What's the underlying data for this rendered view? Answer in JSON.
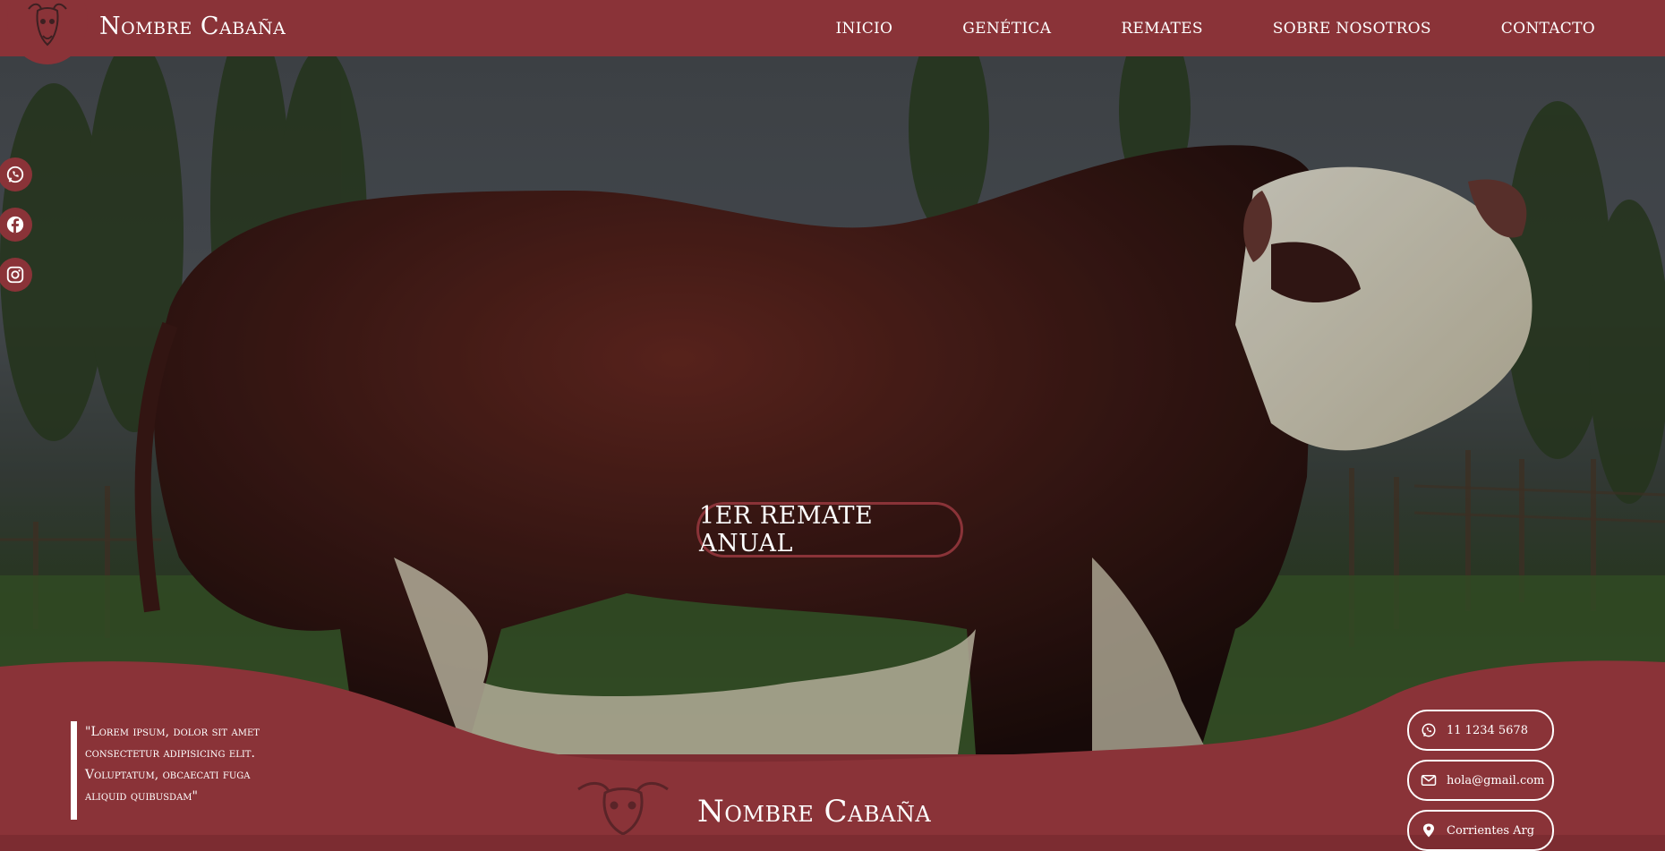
{
  "header": {
    "brand": "Nombre Cabaña",
    "nav": [
      "INICIO",
      "GENÉTICA",
      "REMATES",
      "SOBRE NOSOTROS",
      "CONTACTO"
    ]
  },
  "hero": {
    "cta_label": "1ER REMATE ANUAL"
  },
  "social": {
    "icons": [
      "whatsapp-icon",
      "facebook-icon",
      "instagram-icon"
    ]
  },
  "footer": {
    "quote": "\"Lorem ipsum, dolor sit amet consectetur adipisicing elit. Voluptatum, obcaecati fuga aliquid quibusdam\"",
    "brand": "Nombre Cabaña",
    "contacts": {
      "phone": "11 1234 5678",
      "email": "hola@gmail.com",
      "location": "Corrientes Arg"
    }
  },
  "colors": {
    "primary": "#8a3338",
    "text": "#ffffff"
  }
}
